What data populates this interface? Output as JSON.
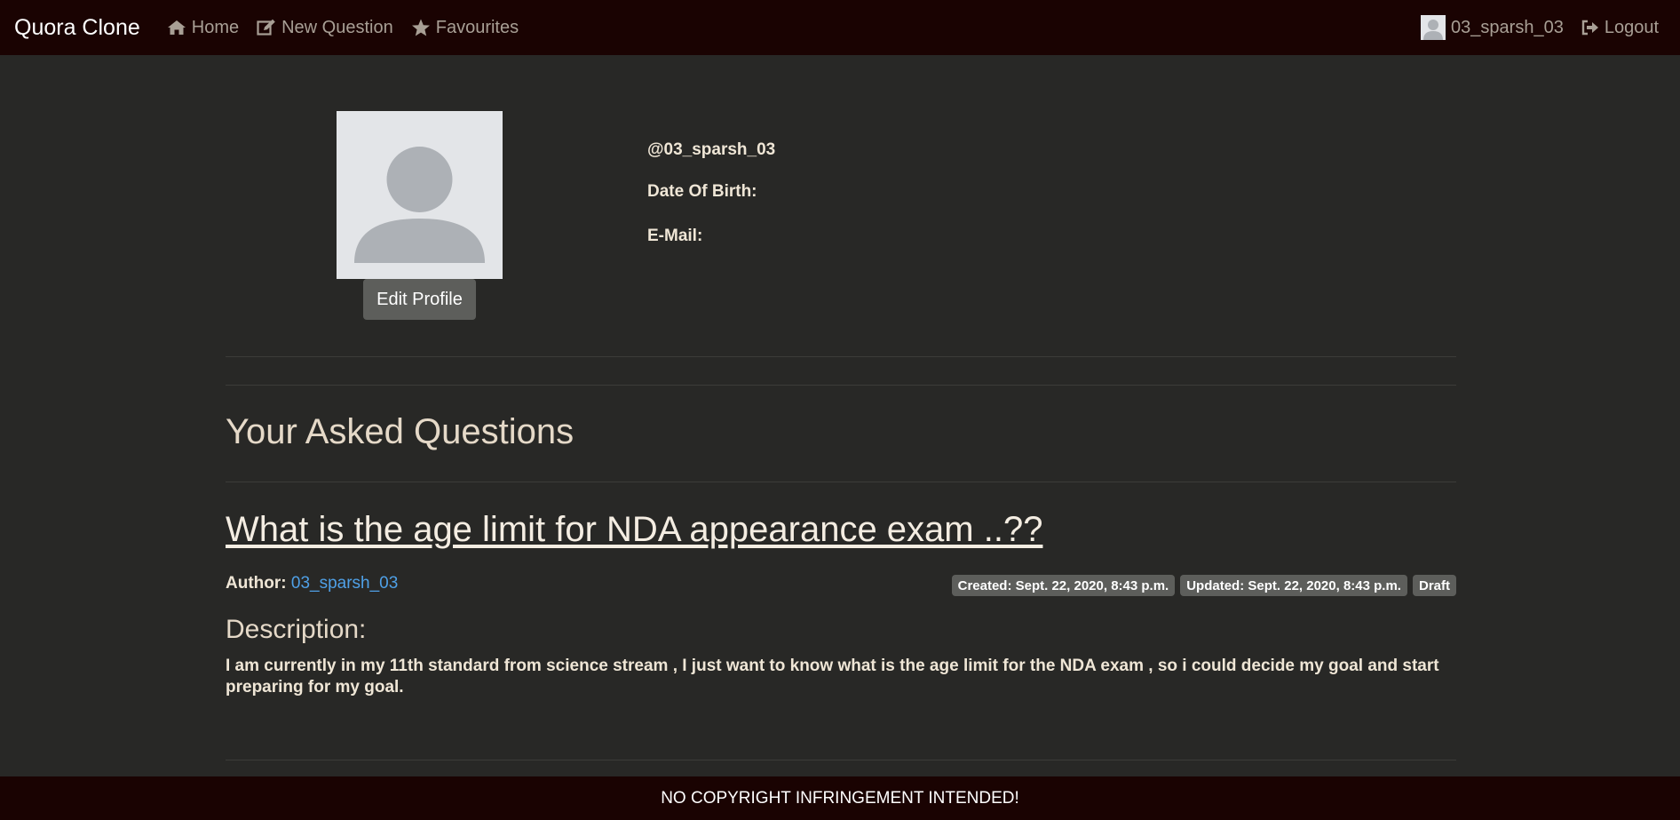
{
  "navbar": {
    "brand": "Quora Clone",
    "links": [
      {
        "label": "Home",
        "icon": "home-icon"
      },
      {
        "label": "New Question",
        "icon": "edit-icon"
      },
      {
        "label": "Favourites",
        "icon": "star-icon"
      }
    ],
    "user": {
      "label": "03_sparsh_03",
      "icon": "avatar"
    },
    "logout": {
      "label": "Logout",
      "icon": "logout-icon"
    }
  },
  "profile": {
    "edit_button": "Edit Profile",
    "handle": "@03_sparsh_03",
    "dob_label": "Date Of Birth:",
    "email_label": "E-Mail:"
  },
  "questions_section": {
    "title": "Your Asked Questions",
    "items": [
      {
        "title": "What is the age limit for NDA appearance exam ..??",
        "author_label": "Author:",
        "author": "03_sparsh_03",
        "created": "Created: Sept. 22, 2020, 8:43 p.m.",
        "updated": "Updated: Sept. 22, 2020, 8:43 p.m.",
        "status": "Draft",
        "description_label": "Description:",
        "description": "I am currently in my 11th standard from science stream , I just want to know what is the age limit for the NDA exam , so i could decide my goal and start preparing for my goal."
      }
    ]
  },
  "footer": {
    "text": "NO COPYRIGHT INFRINGEMENT INTENDED!"
  },
  "colors": {
    "navbar_bg": "#1a0302",
    "page_bg": "#282826",
    "link_blue": "#4fa0e6",
    "badge_bg": "#5d5e5b"
  }
}
